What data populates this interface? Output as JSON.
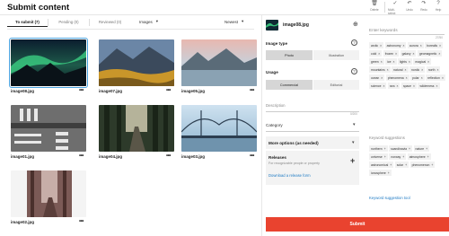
{
  "header": {
    "title": "Submit content",
    "tools": [
      {
        "icon": "trash-icon",
        "glyph": "🗑",
        "label": "Delete"
      },
      {
        "icon": "check-icon",
        "glyph": "✓",
        "label": "Multi-select"
      },
      {
        "icon": "undo-icon",
        "glyph": "↶",
        "label": "Undo"
      },
      {
        "icon": "redo-icon",
        "glyph": "↷",
        "label": "Redo"
      },
      {
        "icon": "help-icon",
        "glyph": "?",
        "label": "Help"
      }
    ]
  },
  "tabs": [
    {
      "label": "To submit (7)",
      "active": true
    },
    {
      "label": "Pending (0)",
      "active": false
    },
    {
      "label": "Reviewed (0)",
      "active": false
    }
  ],
  "filter": {
    "images": "Images",
    "sort": "Newest"
  },
  "images": [
    {
      "name": "image08.jpg",
      "more": "•••",
      "selected": true
    },
    {
      "name": "image07.jpg",
      "more": "•••",
      "selected": false
    },
    {
      "name": "image05.jpg",
      "more": "•••",
      "selected": false
    },
    {
      "name": "image01.jpg",
      "more": "•••",
      "selected": false
    },
    {
      "name": "image04.jpg",
      "more": "•••",
      "selected": false
    },
    {
      "name": "image03.jpg",
      "more": "•••",
      "selected": false
    },
    {
      "name": "image02.jpg",
      "more": "•••",
      "selected": false
    }
  ],
  "details": {
    "file_name": "image08.jpg",
    "image_type_label": "Image type",
    "image_type_options": [
      "Photo",
      "Illustration"
    ],
    "image_type_selected": "Photo",
    "usage_label": "Usage",
    "usage_options": [
      "Commercial",
      "Editorial"
    ],
    "usage_selected": "Commercial",
    "description_label": "Description",
    "description_counter": "0/200",
    "category_label": "Category",
    "more_options_label": "More options (as needed)",
    "releases_title": "Releases",
    "releases_sub": "For recognizable people or property",
    "download_link": "Download a release form"
  },
  "keywords": {
    "label": "Enter keywords",
    "count": "27/50",
    "items": [
      "arctic",
      "astronomy",
      "aurora",
      "borealis",
      "cold",
      "frozen",
      "galaxy",
      "geomagnetic",
      "green",
      "ice",
      "lights",
      "magical",
      "mountains",
      "natural",
      "nordic",
      "north",
      "ocean",
      "phenomena",
      "polar",
      "reflection",
      "science",
      "sea",
      "space",
      "wilderness"
    ],
    "suggestions_label": "Keyword suggestions",
    "suggestions": [
      "northern",
      "scandinavia",
      "nature",
      "universe",
      "norway",
      "atmosphere",
      "astronomical",
      "solar",
      "phenomenon",
      "ionosphere"
    ],
    "suggestion_tool": "Keyword suggestion tool"
  },
  "submit_label": "Submit"
}
